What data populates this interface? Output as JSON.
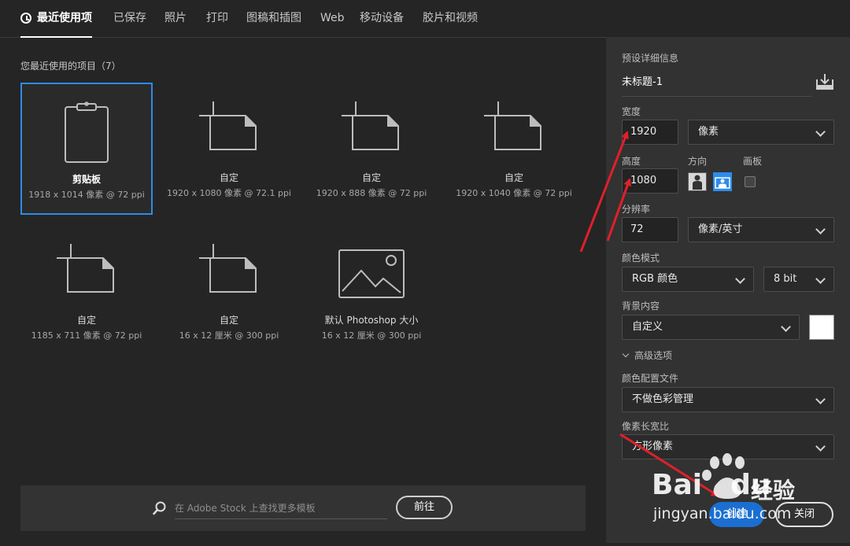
{
  "tabs": [
    {
      "label": "最近使用项",
      "active": true
    },
    {
      "label": "已保存"
    },
    {
      "label": "照片"
    },
    {
      "label": "打印"
    },
    {
      "label": "图稿和插图"
    },
    {
      "label": "Web"
    },
    {
      "label": "移动设备"
    },
    {
      "label": "胶片和视频"
    }
  ],
  "recent": {
    "title": "您最近使用的项目（7）",
    "items": [
      {
        "name": "剪贴板",
        "meta": "1918 x 1014 像素 @ 72 ppi",
        "icon": "clipboard-icon",
        "selected": true
      },
      {
        "name": "自定",
        "meta": "1920 x 1080 像素 @ 72.1 ppi",
        "icon": "custom-document-icon"
      },
      {
        "name": "自定",
        "meta": "1920 x 888 像素 @ 72 ppi",
        "icon": "custom-document-icon"
      },
      {
        "name": "自定",
        "meta": "1920 x 1040 像素 @ 72 ppi",
        "icon": "custom-document-icon"
      },
      {
        "name": "自定",
        "meta": "1185 x 711 像素 @ 72 ppi",
        "icon": "custom-document-icon"
      },
      {
        "name": "自定",
        "meta": "16 x 12 厘米 @ 300 ppi",
        "icon": "custom-document-icon"
      },
      {
        "name": "默认 Photoshop 大小",
        "meta": "16 x 12 厘米 @ 300 ppi",
        "icon": "image-icon"
      }
    ]
  },
  "stock": {
    "placeholder": "在 Adobe Stock 上查找更多模板",
    "go_label": "前往"
  },
  "preset": {
    "section_label": "预设详细信息",
    "name": "未标题-1",
    "width_label": "宽度",
    "width_value": "1920",
    "width_unit": "像素",
    "height_label": "高度",
    "height_value": "1080",
    "orientation_label": "方向",
    "artboard_label": "画板",
    "resolution_label": "分辨率",
    "resolution_value": "72",
    "resolution_unit": "像素/英寸",
    "color_mode_label": "颜色模式",
    "color_mode": "RGB 颜色",
    "bit_depth": "8 bit",
    "background_label": "背景内容",
    "background": "自定义",
    "background_color": "#ffffff",
    "advanced_label": "高级选项",
    "color_profile_label": "颜色配置文件",
    "color_profile": "不做色彩管理",
    "pixel_aspect_label": "像素长宽比",
    "pixel_aspect": "方形像素",
    "create_label": "创建",
    "close_label": "关闭"
  },
  "watermark": {
    "brand": "Bai",
    "brand2": "du",
    "brand_cn": "经验",
    "url": "jingyan.baidu.com"
  },
  "colors": {
    "accent": "#2d8ceb",
    "annotation_arrow": "#e0202a"
  }
}
